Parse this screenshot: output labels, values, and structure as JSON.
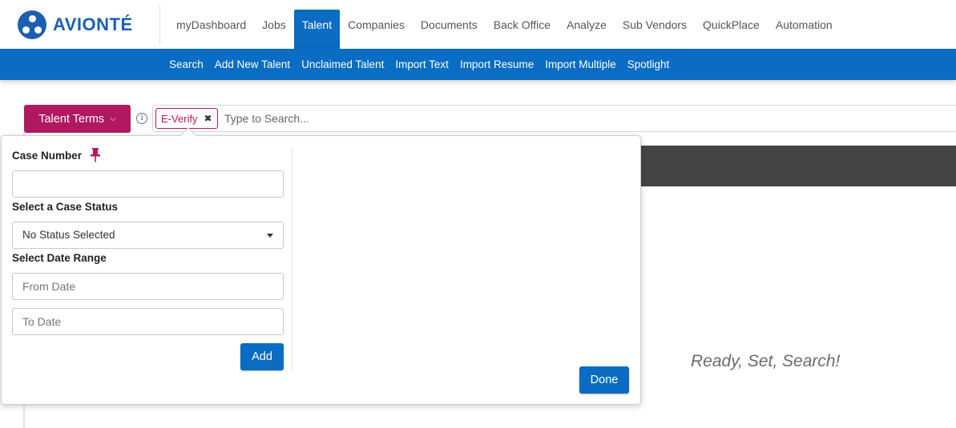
{
  "app": {
    "brand": "AVIONTÉ",
    "brand_color": "#1a5fb4",
    "accent": "#0a6cc2",
    "terms_color": "#b0195f"
  },
  "mainnav": [
    "myDashboard",
    "Jobs",
    "Talent",
    "Companies",
    "Documents",
    "Back Office",
    "Analyze",
    "Sub Vendors",
    "QuickPlace",
    "Automation"
  ],
  "mainnav_active": "Talent",
  "subnav": [
    "Search",
    "Add New Talent",
    "Unclaimed Talent",
    "Import Text",
    "Import Resume",
    "Import Multiple",
    "Spotlight"
  ],
  "search": {
    "terms_label": "Talent Terms",
    "chip": "E-Verify",
    "placeholder": "Type to Search..."
  },
  "popover": {
    "case_number_label": "Case Number",
    "case_number_value": "",
    "case_status_label": "Select a Case Status",
    "case_status_value": "No Status Selected",
    "date_range_label": "Select Date Range",
    "from_placeholder": "From Date",
    "to_placeholder": "To Date",
    "add_label": "Add",
    "done_label": "Done"
  },
  "main": {
    "empty_state": "Ready, Set, Search!"
  }
}
